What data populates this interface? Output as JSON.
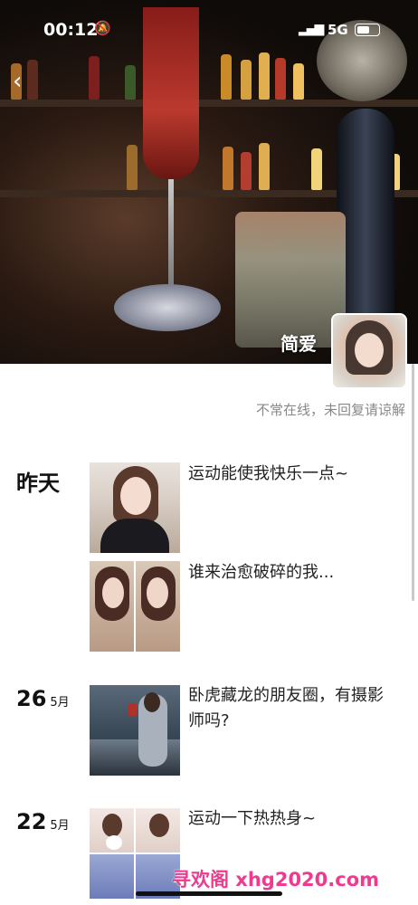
{
  "status_bar": {
    "time": "00:12",
    "network": "5G"
  },
  "profile": {
    "name": "简爱",
    "status_text": "不常在线，未回复请谅解"
  },
  "moments": [
    {
      "date_main": "昨天",
      "date_month": "",
      "posts": [
        {
          "caption": "运动能使我快乐一点~"
        },
        {
          "caption": "谁来治愈破碎的我..."
        }
      ]
    },
    {
      "date_main": "26",
      "date_month": "5月",
      "posts": [
        {
          "caption": "卧虎藏龙的朋友圈，有摄影师吗?"
        }
      ]
    },
    {
      "date_main": "22",
      "date_month": "5月",
      "posts": [
        {
          "caption": "运动一下热热身~"
        }
      ]
    }
  ],
  "watermark": "寻欢阁 xhg2020.com",
  "colors": {
    "watermark": "#ee3a8f"
  }
}
